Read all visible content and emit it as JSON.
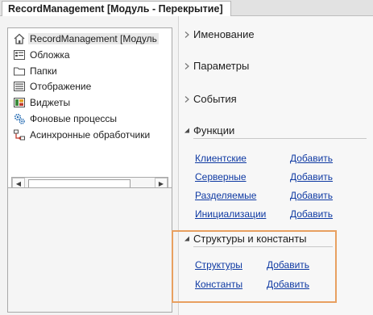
{
  "window": {
    "tab_title": "RecordManagement [Модуль - Перекрытие]"
  },
  "tree": {
    "items": [
      {
        "label": "RecordManagement [Модуль",
        "icon": "home-icon",
        "selected": true
      },
      {
        "label": "Обложка",
        "icon": "cover-icon"
      },
      {
        "label": "Папки",
        "icon": "folder-icon"
      },
      {
        "label": "Отображение",
        "icon": "list-icon"
      },
      {
        "label": "Виджеты",
        "icon": "widget-icon"
      },
      {
        "label": "Фоновые процессы",
        "icon": "gears-icon"
      },
      {
        "label": "Асинхронные обработчики",
        "icon": "async-icon"
      }
    ]
  },
  "sections": {
    "name": {
      "title": "Именование",
      "expanded": false
    },
    "params": {
      "title": "Параметры",
      "expanded": false
    },
    "events": {
      "title": "События",
      "expanded": false
    },
    "functions": {
      "title": "Функции",
      "expanded": true,
      "rows": [
        {
          "label": "Клиентские",
          "action": "Добавить"
        },
        {
          "label": "Серверные",
          "action": "Добавить"
        },
        {
          "label": "Разделяемые",
          "action": "Добавить"
        },
        {
          "label": "Инициализации",
          "action": "Добавить"
        }
      ]
    },
    "structures": {
      "title": "Структуры и константы",
      "expanded": true,
      "rows": [
        {
          "label": "Структуры",
          "action": "Добавить"
        },
        {
          "label": "Константы",
          "action": "Добавить"
        }
      ]
    }
  },
  "colors": {
    "link": "#0f3aa3",
    "highlight": "#e8a060"
  }
}
